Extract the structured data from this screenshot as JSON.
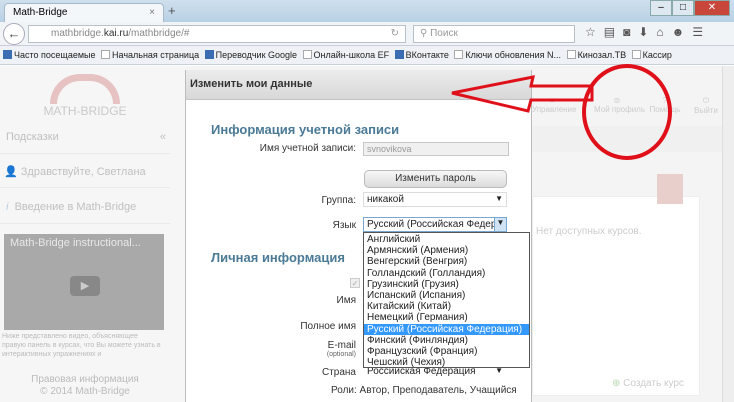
{
  "browser": {
    "tab_title": "Math-Bridge",
    "url_prefix": "mathbridge.",
    "url_host": "kai.ru",
    "url_path": "/mathbridge/#",
    "search_placeholder": "Поиск",
    "bookmarks": [
      "Часто посещаемые",
      "Начальная страница",
      "Переводчик Google",
      "Онлайн-школа EF",
      "ВКонтакте",
      "Ключи обновления N...",
      "Кинозал.ТВ",
      "Кассир"
    ]
  },
  "left": {
    "logo_text": "MATH-BRIDGE",
    "hints_title": "Подсказки",
    "greeting": "Здравствуйте, Светлана",
    "intro": "Введение в Math-Bridge",
    "video_title": "Math-Bridge instructional...",
    "video_caption": "Ниже представлено видео, объясняющее правую панель в курсах, что Вы можете узнать в интерактивных упражнениях и",
    "legal": "Правовая информация",
    "copyright": "© 2014 Math-Bridge"
  },
  "right": {
    "tools": [
      "Управление",
      "Мой профиль",
      "Помощь",
      "Выйти"
    ],
    "no_courses": "Нет доступных курсов.",
    "create_course": "Создать курс"
  },
  "dialog": {
    "title": "Изменить мои данные",
    "account_section": "Информация учетной записи",
    "account_name_label": "Имя учетной записи:",
    "account_name_value": "svnovikova",
    "change_password": "Изменить пароль",
    "group_label": "Группа:",
    "group_value": "никакой",
    "language_label": "Язык",
    "language_value": "Русский (Российская Федерация)",
    "personal_section": "Личная информация",
    "first_name_label": "Имя",
    "full_name_label": "Полное имя",
    "email_label": "E-mail",
    "email_note": "(optional)",
    "country_label": "Страна",
    "country_value": "Российская Федерация",
    "roles": "Роли: Автор, Преподаватель, Учащийся",
    "language_options": [
      "Английский",
      "Армянский (Армения)",
      "Венгерский (Венгрия)",
      "Голландский (Голландия)",
      "Грузинский (Грузия)",
      "Испанский (Испания)",
      "Китайский (Китай)",
      "Немецкий (Германия)",
      "Русский (Российская Федерация)",
      "Финский (Финляндия)",
      "Французский (Франция)",
      "Чешский (Чехия)"
    ],
    "selected_language_index": 8
  },
  "annotation_color": "#e0101a"
}
